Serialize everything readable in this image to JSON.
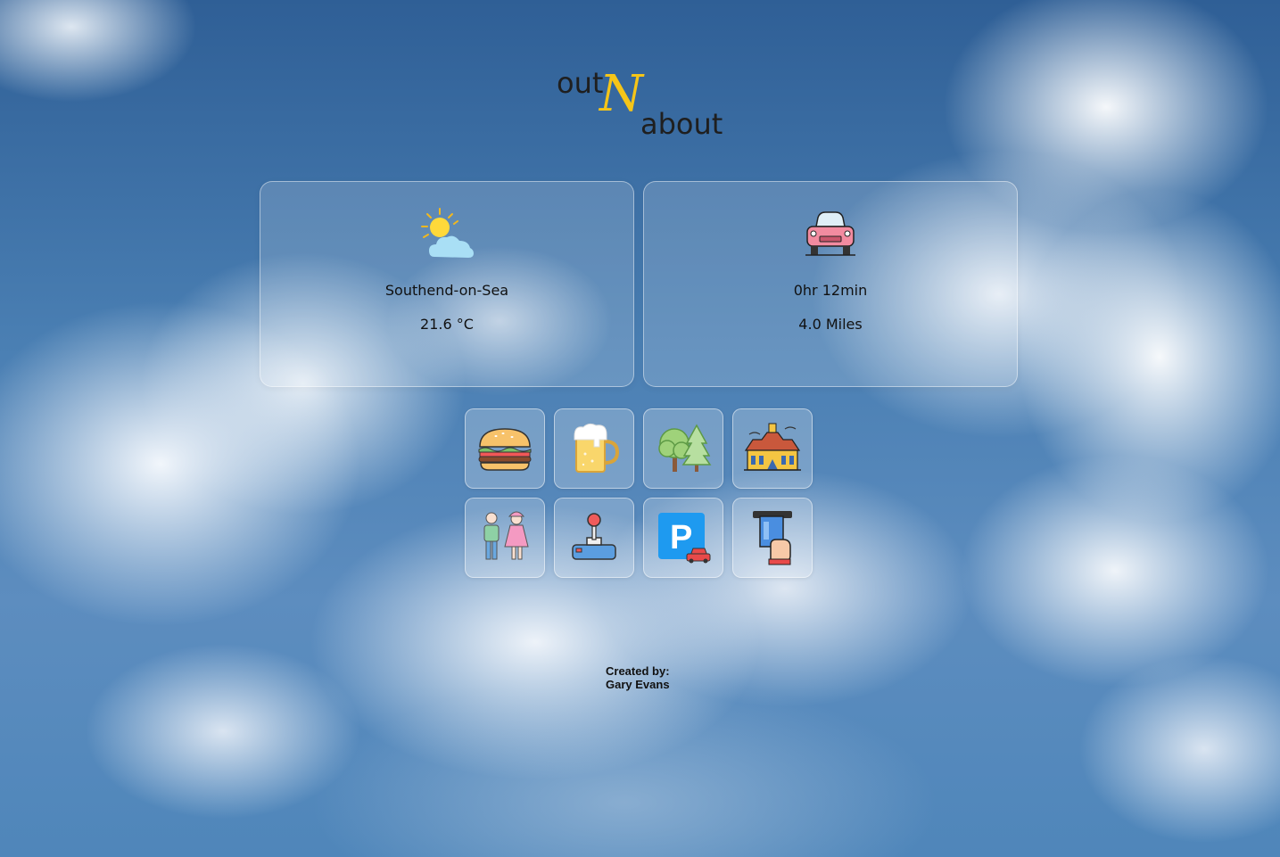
{
  "logo": {
    "word_out": "out",
    "letter_n": "N",
    "word_about": "about",
    "accent_color": "#f5c518"
  },
  "weather": {
    "icon": "sun-cloud-icon",
    "location": "Southend-on-Sea",
    "temperature": "21.6 °C"
  },
  "travel": {
    "icon": "car-icon",
    "duration": "0hr 12min",
    "distance": "4.0 Miles"
  },
  "categories": [
    {
      "icon": "burger-icon"
    },
    {
      "icon": "beer-icon"
    },
    {
      "icon": "trees-icon"
    },
    {
      "icon": "museum-icon"
    },
    {
      "icon": "kids-icon"
    },
    {
      "icon": "joystick-icon"
    },
    {
      "icon": "parking-icon"
    },
    {
      "icon": "atm-icon"
    }
  ],
  "footer": {
    "label": "Created by:",
    "author": "Gary Evans"
  }
}
